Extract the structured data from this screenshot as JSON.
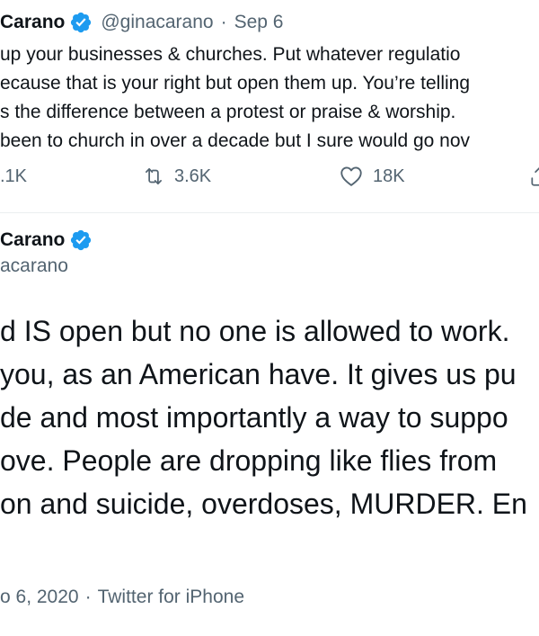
{
  "top_tweet": {
    "author_name": "Carano",
    "handle": "@ginacarano",
    "separator": "·",
    "date": "Sep 6",
    "text_lines": [
      " up your businesses & churches. Put whatever regulatio",
      "ecause that is your right but open them up. You’re telling",
      "s the difference between a protest or praise & worship. ",
      "been to church in over a decade but I sure would go nov"
    ],
    "actions": {
      "reply_count": ".1K",
      "retweet_count": "3.6K",
      "like_count": "18K"
    }
  },
  "main_tweet": {
    "author_name": "Carano",
    "handle": "acarano",
    "text_lines": [
      "d IS open but no one is allowed to work.",
      "you, as an American have. It gives us pu",
      "de and most importantly a way to suppo",
      "ove. People are dropping like flies from",
      "on and suicide, overdoses, MURDER. En"
    ],
    "timestamp": "o 6, 2020",
    "separator": "·",
    "source": "Twitter for iPhone"
  },
  "colors": {
    "verified_badge": "#1d9bf0",
    "secondary_text": "#536471",
    "primary_text": "#0f1419",
    "divider": "#ebeef0"
  },
  "icons": {
    "verified": "verified-badge-icon",
    "retweet": "retweet-icon",
    "like": "heart-icon",
    "share": "share-icon"
  }
}
